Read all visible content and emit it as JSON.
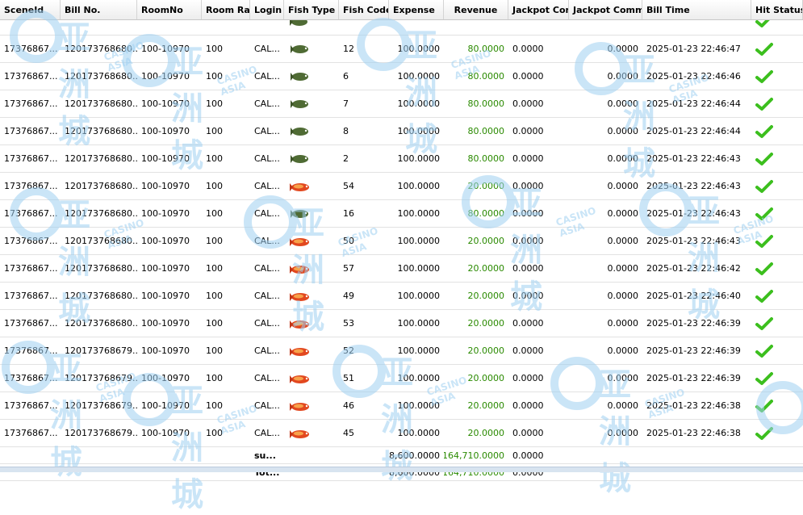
{
  "columns": [
    "SceneId",
    "Bill No.",
    "RoomNo",
    "Room Rat",
    "Login",
    "Fish Type",
    "Fish Code",
    "Expense",
    "Revenue",
    "Jackpot Con",
    "Jackpot Comm",
    "Bill Time",
    "Hit Status"
  ],
  "rows": [
    {
      "scene": "17376867...",
      "bill": "120173768680...",
      "room": "100-10970",
      "rate": "100",
      "login": "CAL...",
      "fish_icon": "green-fish-icon",
      "code": "12",
      "expense": "100.0000",
      "revenue": "80.0000",
      "jc": "0.0000",
      "jcomm": "0.0000",
      "time": "2025-01-23 22:46:47",
      "hit": "check-icon"
    },
    {
      "scene": "17376867...",
      "bill": "120173768680...",
      "room": "100-10970",
      "rate": "100",
      "login": "CAL...",
      "fish_icon": "green-fish-icon",
      "code": "6",
      "expense": "100.0000",
      "revenue": "80.0000",
      "jc": "0.0000",
      "jcomm": "0.0000",
      "time": "2025-01-23 22:46:46",
      "hit": "check-icon"
    },
    {
      "scene": "17376867...",
      "bill": "120173768680...",
      "room": "100-10970",
      "rate": "100",
      "login": "CAL...",
      "fish_icon": "green-fish-icon",
      "code": "7",
      "expense": "100.0000",
      "revenue": "80.0000",
      "jc": "0.0000",
      "jcomm": "0.0000",
      "time": "2025-01-23 22:46:44",
      "hit": "check-icon"
    },
    {
      "scene": "17376867...",
      "bill": "120173768680...",
      "room": "100-10970",
      "rate": "100",
      "login": "CAL...",
      "fish_icon": "green-fish-icon",
      "code": "8",
      "expense": "100.0000",
      "revenue": "80.0000",
      "jc": "0.0000",
      "jcomm": "0.0000",
      "time": "2025-01-23 22:46:44",
      "hit": "check-icon"
    },
    {
      "scene": "17376867...",
      "bill": "120173768680...",
      "room": "100-10970",
      "rate": "100",
      "login": "CAL...",
      "fish_icon": "green-fish-icon",
      "code": "2",
      "expense": "100.0000",
      "revenue": "80.0000",
      "jc": "0.0000",
      "jcomm": "0.0000",
      "time": "2025-01-23 22:46:43",
      "hit": "check-icon"
    },
    {
      "scene": "17376867...",
      "bill": "120173768680...",
      "room": "100-10970",
      "rate": "100",
      "login": "CAL...",
      "fish_icon": "orange-fish-icon",
      "code": "54",
      "expense": "100.0000",
      "revenue": "20.0000",
      "jc": "0.0000",
      "jcomm": "0.0000",
      "time": "2025-01-23 22:46:43",
      "hit": "check-icon"
    },
    {
      "scene": "17376867...",
      "bill": "120173768680...",
      "room": "100-10970",
      "rate": "100",
      "login": "CAL...",
      "fish_icon": "green-fish-icon",
      "code": "16",
      "expense": "100.0000",
      "revenue": "80.0000",
      "jc": "0.0000",
      "jcomm": "0.0000",
      "time": "2025-01-23 22:46:43",
      "hit": "check-icon"
    },
    {
      "scene": "17376867...",
      "bill": "120173768680...",
      "room": "100-10970",
      "rate": "100",
      "login": "CAL...",
      "fish_icon": "orange-fish-icon",
      "code": "50",
      "expense": "100.0000",
      "revenue": "20.0000",
      "jc": "0.0000",
      "jcomm": "0.0000",
      "time": "2025-01-23 22:46:43",
      "hit": "check-icon"
    },
    {
      "scene": "17376867...",
      "bill": "120173768680...",
      "room": "100-10970",
      "rate": "100",
      "login": "CAL...",
      "fish_icon": "orange-fish-icon",
      "code": "57",
      "expense": "100.0000",
      "revenue": "20.0000",
      "jc": "0.0000",
      "jcomm": "0.0000",
      "time": "2025-01-23 22:46:42",
      "hit": "check-icon"
    },
    {
      "scene": "17376867...",
      "bill": "120173768680...",
      "room": "100-10970",
      "rate": "100",
      "login": "CAL...",
      "fish_icon": "orange-fish-icon",
      "code": "49",
      "expense": "100.0000",
      "revenue": "20.0000",
      "jc": "0.0000",
      "jcomm": "0.0000",
      "time": "2025-01-23 22:46:40",
      "hit": "check-icon"
    },
    {
      "scene": "17376867...",
      "bill": "120173768680...",
      "room": "100-10970",
      "rate": "100",
      "login": "CAL...",
      "fish_icon": "orange-fish-icon",
      "code": "53",
      "expense": "100.0000",
      "revenue": "20.0000",
      "jc": "0.0000",
      "jcomm": "0.0000",
      "time": "2025-01-23 22:46:39",
      "hit": "check-icon"
    },
    {
      "scene": "17376867...",
      "bill": "120173768679...",
      "room": "100-10970",
      "rate": "100",
      "login": "CAL...",
      "fish_icon": "orange-fish-icon",
      "code": "52",
      "expense": "100.0000",
      "revenue": "20.0000",
      "jc": "0.0000",
      "jcomm": "0.0000",
      "time": "2025-01-23 22:46:39",
      "hit": "check-icon"
    },
    {
      "scene": "17376867...",
      "bill": "120173768679...",
      "room": "100-10970",
      "rate": "100",
      "login": "CAL...",
      "fish_icon": "orange-fish-icon",
      "code": "51",
      "expense": "100.0000",
      "revenue": "20.0000",
      "jc": "0.0000",
      "jcomm": "0.0000",
      "time": "2025-01-23 22:46:39",
      "hit": "check-icon"
    },
    {
      "scene": "17376867...",
      "bill": "120173768679...",
      "room": "100-10970",
      "rate": "100",
      "login": "CAL...",
      "fish_icon": "orange-fish-icon",
      "code": "46",
      "expense": "100.0000",
      "revenue": "20.0000",
      "jc": "0.0000",
      "jcomm": "0.0000",
      "time": "2025-01-23 22:46:38",
      "hit": "check-icon"
    },
    {
      "scene": "17376867...",
      "bill": "120173768679...",
      "room": "100-10970",
      "rate": "100",
      "login": "CAL...",
      "fish_icon": "orange-fish-icon",
      "code": "45",
      "expense": "100.0000",
      "revenue": "20.0000",
      "jc": "0.0000",
      "jcomm": "0.0000",
      "time": "2025-01-23 22:46:38",
      "hit": "check-icon"
    }
  ],
  "summary": [
    {
      "label": "su...",
      "expense": "8,600.0000",
      "revenue": "164,710.0000",
      "jc": "0.0000"
    },
    {
      "label": "Tot...",
      "expense": "8,600.0000",
      "revenue": "164,710.0000",
      "jc": "0.0000"
    }
  ],
  "watermark": {
    "text": "亚洲城",
    "sub": "CASINO ASIA"
  },
  "colors": {
    "revenue": "#2a8a00",
    "check": "#3cbf1e",
    "watermark": "#9fd0f2"
  }
}
